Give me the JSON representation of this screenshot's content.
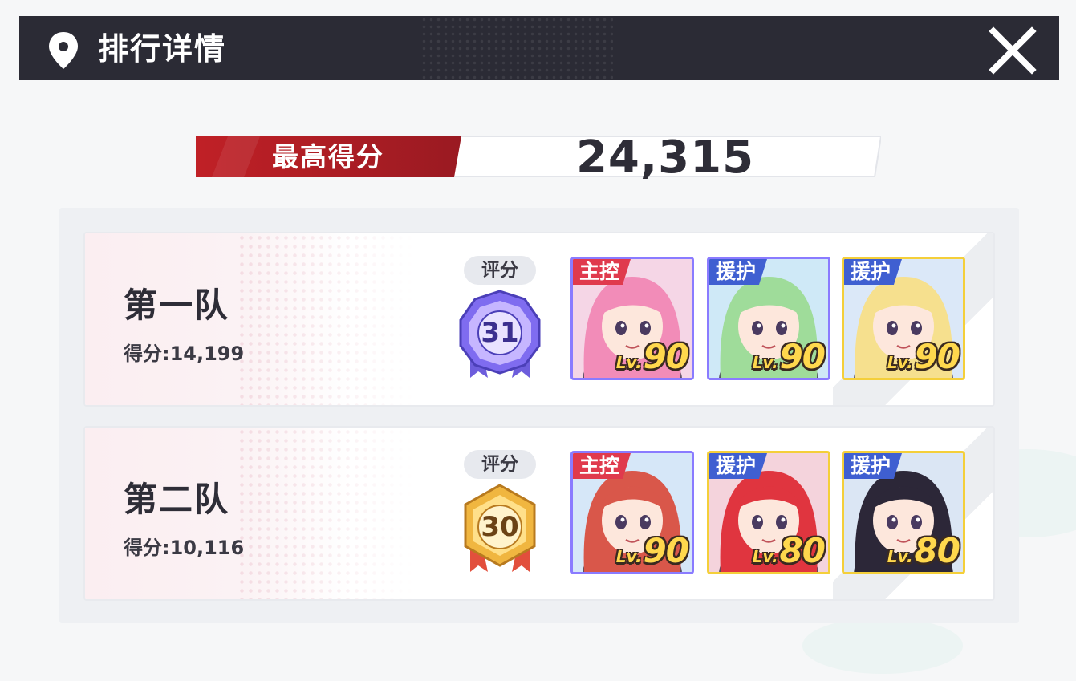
{
  "header": {
    "title": "排行详情"
  },
  "best_score": {
    "label": "最高得分",
    "value": "24,315"
  },
  "teams": [
    {
      "name": "第一队",
      "score_label": "得分:14,199",
      "rating_label": "评分",
      "rating_value": "31",
      "badge_color": "purple",
      "characters": [
        {
          "role": "主控",
          "role_type": "main",
          "level_prefix": "Lv.",
          "level": "90",
          "frame_color": "#8a7bff",
          "hair_color": "#f28cb8",
          "bg_color": "#f5d6e6"
        },
        {
          "role": "援护",
          "role_type": "support",
          "level_prefix": "Lv.",
          "level": "90",
          "frame_color": "#8a7bff",
          "hair_color": "#9fdc9a",
          "bg_color": "#cfe9f7"
        },
        {
          "role": "援护",
          "role_type": "support",
          "level_prefix": "Lv.",
          "level": "90",
          "frame_color": "#f4cf3a",
          "hair_color": "#f6e08e",
          "bg_color": "#dbe8f8"
        }
      ]
    },
    {
      "name": "第二队",
      "score_label": "得分:10,116",
      "rating_label": "评分",
      "rating_value": "30",
      "badge_color": "gold",
      "characters": [
        {
          "role": "主控",
          "role_type": "main",
          "level_prefix": "Lv.",
          "level": "90",
          "frame_color": "#8a7bff",
          "hair_color": "#d9574a",
          "bg_color": "#d6e7f8"
        },
        {
          "role": "援护",
          "role_type": "support",
          "level_prefix": "Lv.",
          "level": "80",
          "frame_color": "#f4cf3a",
          "hair_color": "#e0353f",
          "bg_color": "#f4d3dc"
        },
        {
          "role": "援护",
          "role_type": "support",
          "level_prefix": "Lv.",
          "level": "80",
          "frame_color": "#f4cf3a",
          "hair_color": "#2c2738",
          "bg_color": "#dbe6f4"
        }
      ]
    }
  ],
  "icons": {
    "location": "map-pin-icon",
    "close": "close-icon"
  }
}
